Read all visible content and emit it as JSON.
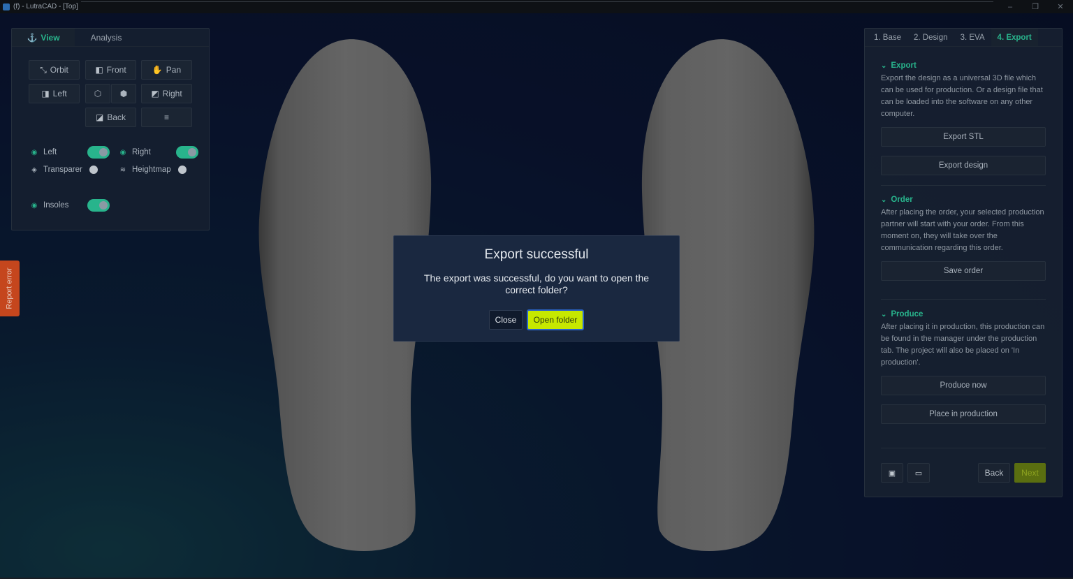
{
  "window": {
    "title": "(f) - LutraCAD - [Top]",
    "controls": {
      "minimize": "–",
      "restore": "❐",
      "close": "✕"
    }
  },
  "view_panel": {
    "tabs": [
      {
        "label": "View",
        "icon": "anchor-icon",
        "active": true
      },
      {
        "label": "Analysis",
        "active": false
      }
    ],
    "buttons": {
      "orbit": "Orbit",
      "front": "Front",
      "pan": "Pan",
      "left": "Left",
      "right": "Right",
      "back": "Back"
    },
    "toggles": {
      "left": {
        "label": "Left",
        "on": true
      },
      "right": {
        "label": "Right",
        "on": true
      },
      "transparent": {
        "label": "Transparer",
        "on": false
      },
      "heightmap": {
        "label": "Heightmap",
        "on": false
      },
      "insoles": {
        "label": "Insoles",
        "on": true
      }
    }
  },
  "report_error": {
    "label": "Report error"
  },
  "right_panel": {
    "tabs": [
      {
        "label": "1. Base",
        "active": false
      },
      {
        "label": "2. Design",
        "active": false
      },
      {
        "label": "3. EVA",
        "active": false
      },
      {
        "label": "4. Export",
        "active": true
      }
    ],
    "export": {
      "title": "Export",
      "description": "Export the design as a universal 3D file which can be used for production. Or a design file that can be loaded into the software on any other computer.",
      "export_stl": "Export STL",
      "export_design": "Export design"
    },
    "order": {
      "title": "Order",
      "description": "After placing the order, your selected production partner will start with your order. From this moment on, they will take over the communication regarding this order.",
      "save_order": "Save order"
    },
    "produce": {
      "title": "Produce",
      "description": "After placing it in production, this production can be found in the manager under the production tab. The project will also be placed on 'In production'.",
      "produce_now": "Produce now",
      "place_in_production": "Place in production"
    },
    "footer": {
      "back": "Back",
      "next": "Next"
    }
  },
  "modal": {
    "title": "Export successful",
    "message": "The export was successful, do you want to open the correct folder?",
    "close": "Close",
    "open_folder": "Open folder"
  },
  "colors": {
    "accent": "#28b48c",
    "open_folder_bg": "#c6e800",
    "next_bg": "#5a6e10",
    "report_error_bg": "#c5461d"
  }
}
